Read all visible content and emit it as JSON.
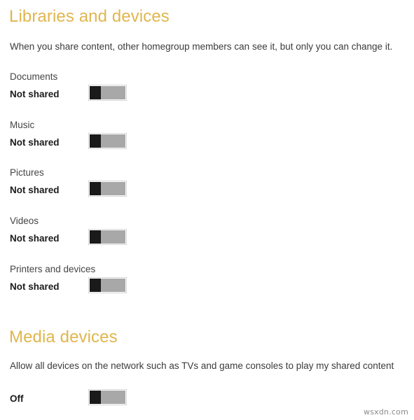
{
  "colors": {
    "heading": "#e0b64e",
    "body_text": "#3b3b3b",
    "state_text": "#1b1b1b",
    "toggle_track": "#a8a8a8",
    "toggle_thumb": "#1a1a1a",
    "background": "#ffffff",
    "watermark": "#8a8a8a"
  },
  "libraries_section": {
    "heading": "Libraries and devices",
    "description": "When you share content, other homegroup members can see it, but only you can change it.",
    "rows": [
      {
        "label": "Documents",
        "state": "Not shared",
        "toggle_state": "off"
      },
      {
        "label": "Music",
        "state": "Not shared",
        "toggle_state": "off"
      },
      {
        "label": "Pictures",
        "state": "Not shared",
        "toggle_state": "off"
      },
      {
        "label": "Videos",
        "state": "Not shared",
        "toggle_state": "off"
      },
      {
        "label": "Printers and devices",
        "state": "Not shared",
        "toggle_state": "off"
      }
    ]
  },
  "media_section": {
    "heading": "Media devices",
    "description": "Allow all devices on the network such as TVs and game consoles to play my shared content",
    "rows": [
      {
        "label": "",
        "state": "Off",
        "toggle_state": "off"
      }
    ]
  },
  "watermark": {
    "text": "wsxdn.com"
  }
}
